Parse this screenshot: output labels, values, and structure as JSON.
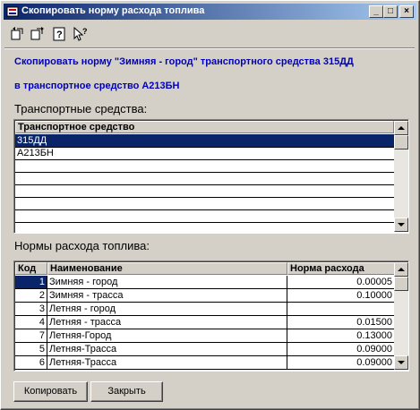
{
  "window": {
    "title": "Скопировать норму расхода топлива",
    "controls": {
      "minimize": "_",
      "maximize": "□",
      "close": "×"
    }
  },
  "toolbar": {
    "icons": [
      "copy-back-icon",
      "copy-forward-icon",
      "help-icon",
      "context-help-icon"
    ]
  },
  "info": {
    "line1": "Скопировать норму \"Зимняя - город\" транспортного средства 315ДД",
    "line2": "в транспортное средство А213БН"
  },
  "vehicles": {
    "section_label": "Транспортные средства:",
    "column": "Транспортное средство",
    "rows": [
      "315ДД",
      "А213БН",
      "",
      "",
      "",
      "",
      "",
      ""
    ],
    "selected_index": 0
  },
  "norms": {
    "section_label": "Нормы расхода топлива:",
    "columns": [
      "Код",
      "Наименование",
      "Норма расхода"
    ],
    "rows": [
      {
        "code": "1",
        "name": "Зимняя - город",
        "norm": "0.00005"
      },
      {
        "code": "2",
        "name": "Зимняя - трасса",
        "norm": "0.10000"
      },
      {
        "code": "3",
        "name": "Летняя - город",
        "norm": ""
      },
      {
        "code": "4",
        "name": "Летняя - трасса",
        "norm": "0.01500"
      },
      {
        "code": "7",
        "name": "Летняя-Город",
        "norm": "0.13000"
      },
      {
        "code": "5",
        "name": "Летняя-Трасса",
        "norm": "0.09000"
      },
      {
        "code": "6",
        "name": "Летняя-Трасса",
        "norm": "0.09000"
      }
    ],
    "selected_code_index": 0
  },
  "buttons": {
    "copy": "Копировать",
    "close": "Закрыть"
  }
}
